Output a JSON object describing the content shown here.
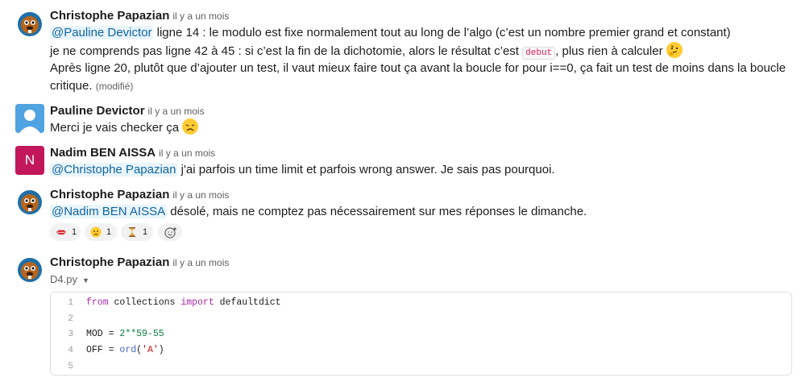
{
  "messages": [
    {
      "author": "Christophe Papazian",
      "time": "il y a un mois",
      "lines": {
        "l1_mention": "@Pauline Devictor",
        "l1_text": " ligne 14 : le modulo est fixe normalement tout au long de l’algo (c’est un nombre premier grand et constant)",
        "l2_text": "je ne comprends pas ligne 42 à 45 : si c’est la fin de la dichotomie, alors le résultat c’est ",
        "l2_code": "debut",
        "l2_text_after": ", plus rien à calculer ",
        "l3_text": "Après ligne 20, plutôt que d’ajouter un test, il vaut mieux faire tout ça avant la boucle for pour i==0, ça fait un test de moins dans la boucle",
        "l4_text": "critique. ",
        "edited": "(modifié)"
      }
    },
    {
      "author": "Pauline Devictor",
      "time": "il y a un mois",
      "text": "Merci je vais checker ça "
    },
    {
      "author": "Nadim BEN AISSA",
      "time": "il y a un mois",
      "avatar_letter": "N",
      "mention": "@Christophe Papazian",
      "text": " j'ai parfois un time limit et parfois wrong answer. Je sais pas pourquoi."
    },
    {
      "author": "Christophe Papazian",
      "time": "il y a un mois",
      "mention": "@Nadim BEN AISSA",
      "text": " désolé, mais ne comptez pas nécessairement sur mes réponses le dimanche.",
      "reactions": [
        {
          "icon": "lips-icon",
          "count": "1"
        },
        {
          "icon": "sad-face-icon",
          "count": "1"
        },
        {
          "icon": "hourglass-icon",
          "count": "1"
        }
      ]
    },
    {
      "author": "Christophe Papazian",
      "time": "il y a un mois",
      "file_name": "D4.py",
      "code": {
        "line_numbers": [
          "1",
          "2",
          "3",
          "4",
          "5"
        ],
        "l1_kw1": "from",
        "l1_mod": " collections ",
        "l1_kw2": "import",
        "l1_name": " defaultdict",
        "l3_a": "MOD = ",
        "l3_b": "2**59-55",
        "l4_a": "OFF = ",
        "l4_fn": "ord",
        "l4_b": "(",
        "l4_str": "'A'",
        "l4_c": ")"
      }
    }
  ],
  "colors": {
    "mention_bg": "#e8f5fa",
    "mention_text": "#1264a3",
    "nadim_avatar": "#c2185b",
    "pauline_avatar": "#4fa3e0",
    "inline_code": "#e01e5a"
  }
}
